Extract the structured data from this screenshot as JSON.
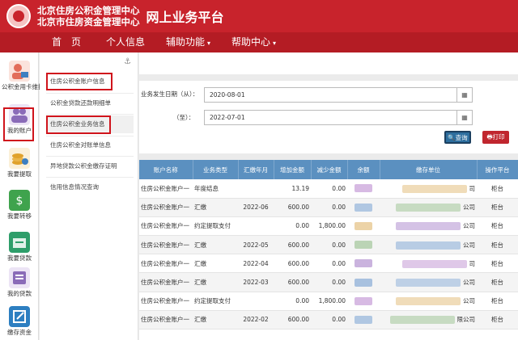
{
  "header": {
    "org_names": [
      "北京住房公积金管理中心",
      "北京市住房资金管理中心"
    ],
    "platform_title": "网上业务平台",
    "brand_color": "#c8232c"
  },
  "nav": {
    "items": [
      {
        "label": "首　页",
        "has_dropdown": false
      },
      {
        "label": "个人信息",
        "has_dropdown": false
      },
      {
        "label": "辅助功能",
        "has_dropdown": true
      },
      {
        "label": "帮助中心",
        "has_dropdown": true
      }
    ],
    "caret": "▾"
  },
  "sidebar": {
    "items": [
      {
        "label": "公积金用卡维护",
        "icon": "user-card-icon",
        "color": "#e26d5a"
      },
      {
        "label": "我的账户",
        "icon": "users-icon",
        "color": "#8a6bb8"
      },
      {
        "label": "我要提取",
        "icon": "coins-icon",
        "color": "#e0a22c"
      },
      {
        "label": "我要转移",
        "icon": "transfer-icon",
        "color": "#3fa34d"
      },
      {
        "label": "我要贷款",
        "icon": "house-icon",
        "color": "#2e9e6a"
      },
      {
        "label": "我的贷款",
        "icon": "loan-icon",
        "color": "#8a6bb8"
      },
      {
        "label": "缴存资金",
        "icon": "edit-icon",
        "color": "#2d7fc1"
      }
    ]
  },
  "submenu": {
    "anchor_icon": "⚓",
    "items": [
      {
        "label": "住房公积金账户信息"
      },
      {
        "label": "公积金贷款还款明细单"
      },
      {
        "label": "住房公积金业务信息"
      },
      {
        "label": "住房公积金对账单信息"
      },
      {
        "label": "异地贷款公积金缴存证明"
      },
      {
        "label": "信用信息情况查询"
      }
    ]
  },
  "form": {
    "date_from_label": "业务发生日期（从）：",
    "date_from_value": "2020-08-01",
    "date_to_label": "（至）：",
    "date_to_value": "2022-07-01",
    "calendar_icon": "▦",
    "query_label": "🔍查询",
    "print_label": "🖶打印"
  },
  "table": {
    "headers": [
      "账户名称",
      "业务类型",
      "汇缴年月",
      "增加金额",
      "减少金额",
      "余额",
      "缴存单位",
      "操作平台"
    ],
    "rows": [
      {
        "name": "住房公积金账户一",
        "type": "年度结息",
        "month": "",
        "add": "13.19",
        "sub": "0.00",
        "unit_tail": "司",
        "platform": "柜台"
      },
      {
        "name": "住房公积金账户一",
        "type": "汇缴",
        "month": "2022-06",
        "add": "600.00",
        "sub": "0.00",
        "unit_tail": "公司",
        "platform": "柜台"
      },
      {
        "name": "住房公积金账户一",
        "type": "约定提取支付",
        "month": "",
        "add": "0.00",
        "sub": "1,800.00",
        "unit_tail": "公司",
        "platform": "柜台"
      },
      {
        "name": "住房公积金账户一",
        "type": "汇缴",
        "month": "2022-05",
        "add": "600.00",
        "sub": "0.00",
        "unit_tail": "公司",
        "platform": "柜台"
      },
      {
        "name": "住房公积金账户一",
        "type": "汇缴",
        "month": "2022-04",
        "add": "600.00",
        "sub": "0.00",
        "unit_tail": "司",
        "platform": "柜台"
      },
      {
        "name": "住房公积金账户一",
        "type": "汇缴",
        "month": "2022-03",
        "add": "600.00",
        "sub": "0.00",
        "unit_tail": "公司",
        "platform": "柜台"
      },
      {
        "name": "住房公积金账户一",
        "type": "约定提取支付",
        "month": "",
        "add": "0.00",
        "sub": "1,800.00",
        "unit_tail": "公司",
        "platform": "柜台"
      },
      {
        "name": "住房公积金账户一",
        "type": "汇缴",
        "month": "2022-02",
        "add": "600.00",
        "sub": "0.00",
        "unit_tail": "限公司",
        "platform": "柜台"
      }
    ]
  }
}
